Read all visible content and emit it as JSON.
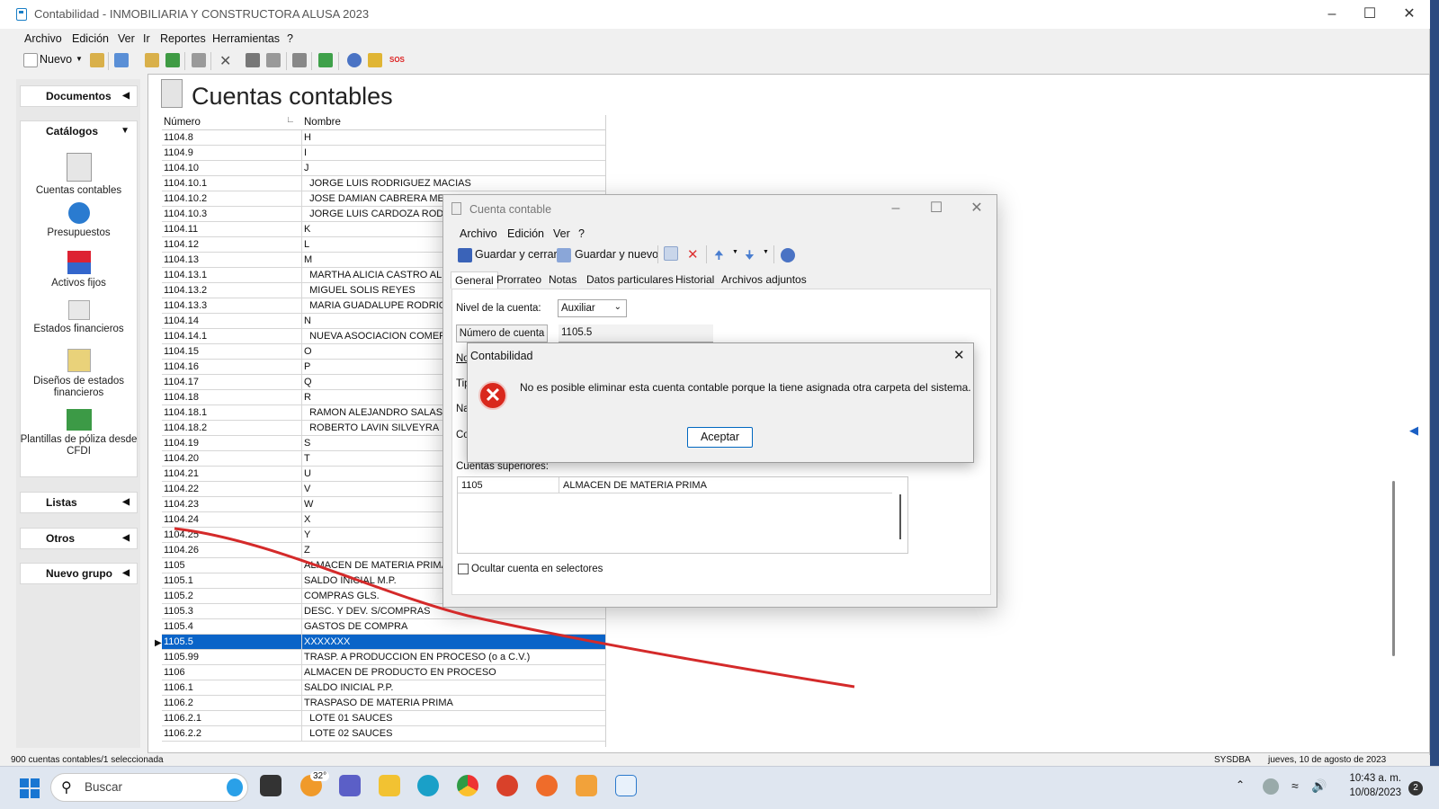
{
  "window": {
    "title": "Contabilidad - INMOBILIARIA Y CONSTRUCTORA ALUSA 2023"
  },
  "menu": [
    "Archivo",
    "Edición",
    "Ver",
    "Ir",
    "Reportes",
    "Herramientas",
    "?"
  ],
  "toolbar": {
    "new_label": "Nuevo",
    "sos_label": "SOS"
  },
  "sidebar": {
    "documentos": "Documentos",
    "catalogos": "Catálogos",
    "catalog_items": [
      "Cuentas contables",
      "Presupuestos",
      "Activos fijos",
      "Estados financieros",
      "Diseños de estados financieros",
      "Plantillas de póliza desde CFDI"
    ],
    "listas": "Listas",
    "otros": "Otros",
    "nuevo_grupo": "Nuevo grupo"
  },
  "page": {
    "title": "Cuentas contables"
  },
  "grid": {
    "headers": [
      "Número",
      "Nombre"
    ],
    "selected_index": 33,
    "rows": [
      [
        "1104.8",
        "H"
      ],
      [
        "1104.9",
        "I"
      ],
      [
        "1104.10",
        "J"
      ],
      [
        "1104.10.1",
        "  JORGE LUIS RODRIGUEZ MACIAS"
      ],
      [
        "1104.10.2",
        "  JOSE DAMIAN CABRERA MED"
      ],
      [
        "1104.10.3",
        "  JORGE LUIS CARDOZA RODR"
      ],
      [
        "1104.11",
        "K"
      ],
      [
        "1104.12",
        "L"
      ],
      [
        "1104.13",
        "M"
      ],
      [
        "1104.13.1",
        "  MARTHA ALICIA CASTRO AL"
      ],
      [
        "1104.13.2",
        "  MIGUEL SOLIS REYES"
      ],
      [
        "1104.13.3",
        "  MARIA GUADALUPE RODRIGU"
      ],
      [
        "1104.14",
        "N"
      ],
      [
        "1104.14.1",
        "  NUEVA ASOCIACION COMER"
      ],
      [
        "1104.15",
        "O"
      ],
      [
        "1104.16",
        "P"
      ],
      [
        "1104.17",
        "Q"
      ],
      [
        "1104.18",
        "R"
      ],
      [
        "1104.18.1",
        "  RAMON ALEJANDRO SALAS C"
      ],
      [
        "1104.18.2",
        "  ROBERTO LAVIN SILVEYRA"
      ],
      [
        "1104.19",
        "S"
      ],
      [
        "1104.20",
        "T"
      ],
      [
        "1104.21",
        "U"
      ],
      [
        "1104.22",
        "V"
      ],
      [
        "1104.23",
        "W"
      ],
      [
        "1104.24",
        "X"
      ],
      [
        "1104.25",
        "Y"
      ],
      [
        "1104.26",
        "Z"
      ],
      [
        "1105",
        "ALMACEN DE MATERIA PRIMA"
      ],
      [
        "1105.1",
        "SALDO INICIAL M.P."
      ],
      [
        "1105.2",
        "COMPRAS GLS."
      ],
      [
        "1105.3",
        "DESC. Y DEV. S/COMPRAS"
      ],
      [
        "1105.4",
        "GASTOS DE COMPRA"
      ],
      [
        "1105.5",
        "XXXXXXX"
      ],
      [
        "1105.99",
        "TRASP. A PRODUCCION EN PROCESO (o a C.V.)"
      ],
      [
        "1106",
        "ALMACEN DE PRODUCTO EN PROCESO"
      ],
      [
        "1106.1",
        "SALDO INICIAL P.P."
      ],
      [
        "1106.2",
        "TRASPASO DE MATERIA PRIMA"
      ],
      [
        "1106.2.1",
        "  LOTE 01 SAUCES"
      ],
      [
        "1106.2.2",
        "  LOTE 02 SAUCES"
      ]
    ]
  },
  "status": {
    "left": "900 cuentas contables/1 seleccionada",
    "user": "SYSDBA",
    "date": "jueves, 10 de agosto de 2023"
  },
  "dialog": {
    "title": "Cuenta contable",
    "menu": [
      "Archivo",
      "Edición",
      "Ver",
      "?"
    ],
    "save_close": "Guardar y cerrar",
    "save_new": "Guardar y nuevo",
    "tabs": [
      "General",
      "Prorrateo",
      "Notas",
      "Datos particulares",
      "Historial",
      "Archivos adjuntos"
    ],
    "nivel_label": "Nivel de la cuenta:",
    "nivel_value": "Auxiliar",
    "numero_button": "Número de cuenta",
    "numero_value": "1105.5",
    "partial_labels": [
      "No",
      "Tip",
      "Na",
      "Co"
    ],
    "superiores_label": "Cuentas superiores:",
    "superiores": [
      [
        "1105",
        "ALMACEN DE MATERIA PRIMA"
      ]
    ],
    "ocultar_label": "Ocultar cuenta en selectores"
  },
  "alert": {
    "title": "Contabilidad",
    "message": "No es posible eliminar esta cuenta contable porque la tiene asignada otra carpeta del sistema.",
    "ok": "Aceptar"
  },
  "taskbar": {
    "search_placeholder": "Buscar",
    "weather": "32°",
    "time": "10:43 a. m.",
    "date": "10/08/2023",
    "notifications": "2"
  }
}
